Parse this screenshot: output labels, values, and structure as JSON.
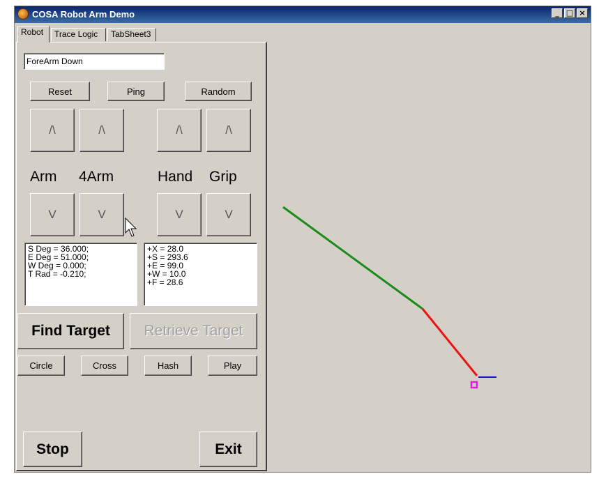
{
  "window": {
    "title": "COSA Robot Arm Demo",
    "controls": [
      "_",
      "□",
      "×"
    ]
  },
  "tabs": [
    "Robot",
    "Trace Logic",
    "TabSheet3"
  ],
  "status_field": "ForeArm Down",
  "buttons": {
    "reset": "Reset",
    "ping": "Ping",
    "random": "Random",
    "up": "/\\",
    "down": "V",
    "find_target": "Find Target",
    "retrieve_target": "Retrieve Target",
    "circle": "Circle",
    "cross": "Cross",
    "hash": "Hash",
    "play": "Play",
    "stop": "Stop",
    "exit": "Exit"
  },
  "joint_labels": {
    "arm": "Arm",
    "forearm": "4Arm",
    "hand": "Hand",
    "grip": "Grip"
  },
  "angles_memo": "S Deg = 36.000;\nE Deg = 51.000;\nW Deg = 0.000;\nT Rad = -0.210;",
  "coords_memo": "+X = 28.0\n+S = 293.6\n+E = 99.0\n+W = 10.0\n+F = 28.6",
  "colors": {
    "upper_arm": "#1a8a1a",
    "forearm": "#ee1111",
    "hand": "#1010dd",
    "target": "#e020e0"
  }
}
